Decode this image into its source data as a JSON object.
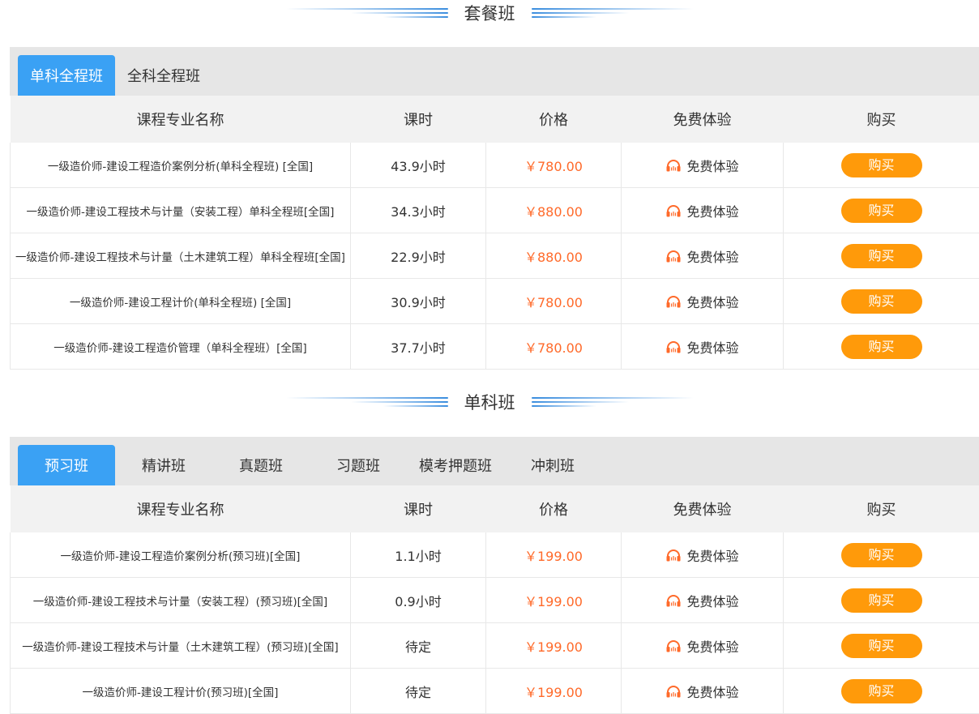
{
  "package": {
    "title": "套餐班",
    "tabs": [
      {
        "label": "单科全程班"
      },
      {
        "label": "全科全程班"
      }
    ],
    "headers": [
      "课程专业名称",
      "课时",
      "价格",
      "免费体验",
      "购买"
    ],
    "rows": [
      {
        "name": "一级造价师-建设工程造价案例分析(单科全程班) [全国]",
        "hours": "43.9小时",
        "price": "￥780.00",
        "trial": "免费体验",
        "buy": "购买"
      },
      {
        "name": "一级造价师-建设工程技术与计量（安装工程）单科全程班[全国]",
        "hours": "34.3小时",
        "price": "￥880.00",
        "trial": "免费体验",
        "buy": "购买"
      },
      {
        "name": "一级造价师-建设工程技术与计量（土木建筑工程）单科全程班[全国]",
        "hours": "22.9小时",
        "price": "￥880.00",
        "trial": "免费体验",
        "buy": "购买"
      },
      {
        "name": "一级造价师-建设工程计价(单科全程班) [全国]",
        "hours": "30.9小时",
        "price": "￥780.00",
        "trial": "免费体验",
        "buy": "购买"
      },
      {
        "name": "一级造价师-建设工程造价管理（单科全程班）[全国]",
        "hours": "37.7小时",
        "price": "￥780.00",
        "trial": "免费体验",
        "buy": "购买"
      }
    ]
  },
  "single": {
    "title": "单科班",
    "tabs": [
      {
        "label": "预习班"
      },
      {
        "label": "精讲班"
      },
      {
        "label": "真题班"
      },
      {
        "label": "习题班"
      },
      {
        "label": "模考押题班"
      },
      {
        "label": "冲刺班"
      }
    ],
    "headers": [
      "课程专业名称",
      "课时",
      "价格",
      "免费体验",
      "购买"
    ],
    "rows": [
      {
        "name": "一级造价师-建设工程造价案例分析(预习班)[全国]",
        "hours": "1.1小时",
        "price": "￥199.00",
        "trial": "免费体验",
        "buy": "购买"
      },
      {
        "name": "一级造价师-建设工程技术与计量（安装工程）(预习班)[全国]",
        "hours": "0.9小时",
        "price": "￥199.00",
        "trial": "免费体验",
        "buy": "购买"
      },
      {
        "name": "一级造价师-建设工程技术与计量（土木建筑工程）(预习班)[全国]",
        "hours": "待定",
        "price": "￥199.00",
        "trial": "免费体验",
        "buy": "购买"
      },
      {
        "name": "一级造价师-建设工程计价(预习班)[全国]",
        "hours": "待定",
        "price": "￥199.00",
        "trial": "免费体验",
        "buy": "购买"
      }
    ]
  },
  "icons": {
    "trial": "headphones-icon"
  },
  "colors": {
    "accent": "#3aa1f4",
    "price": "#ff6a2a",
    "buy": "#ff9a0a"
  }
}
